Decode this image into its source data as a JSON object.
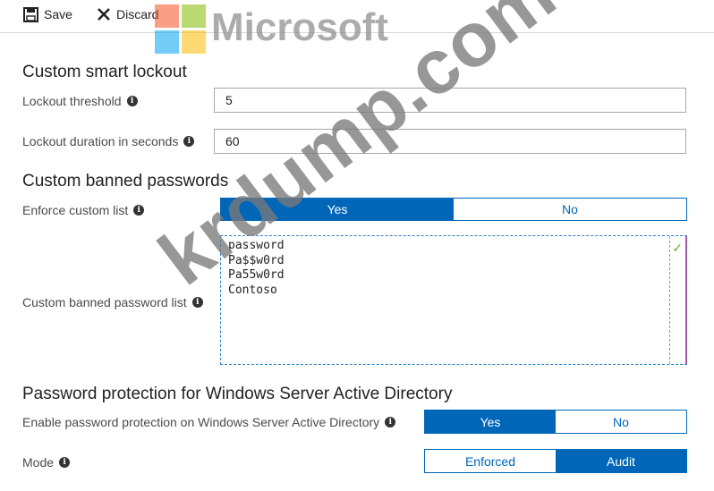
{
  "toolbar": {
    "save_label": "Save",
    "discard_label": "Discard"
  },
  "watermark": {
    "logo_text": "Microsoft",
    "overlay_text": "krdump.com"
  },
  "smart_lockout": {
    "title": "Custom smart lockout",
    "threshold_label": "Lockout threshold",
    "threshold_value": "5",
    "duration_label": "Lockout duration in seconds",
    "duration_value": "60"
  },
  "banned_passwords": {
    "title": "Custom banned passwords",
    "enforce_label": "Enforce custom list",
    "enforce_yes": "Yes",
    "enforce_no": "No",
    "list_label": "Custom banned password list",
    "list": [
      "password",
      "Pa$$w0rd",
      "Pa55w0rd",
      "Contoso"
    ]
  },
  "ad_protection": {
    "title": "Password protection for Windows Server Active Directory",
    "enable_label": "Enable password protection on Windows Server Active Directory",
    "enable_yes": "Yes",
    "enable_no": "No",
    "mode_label": "Mode",
    "mode_enforced": "Enforced",
    "mode_audit": "Audit"
  },
  "colors": {
    "accent": "#0067b8",
    "check": "#6ab023"
  }
}
